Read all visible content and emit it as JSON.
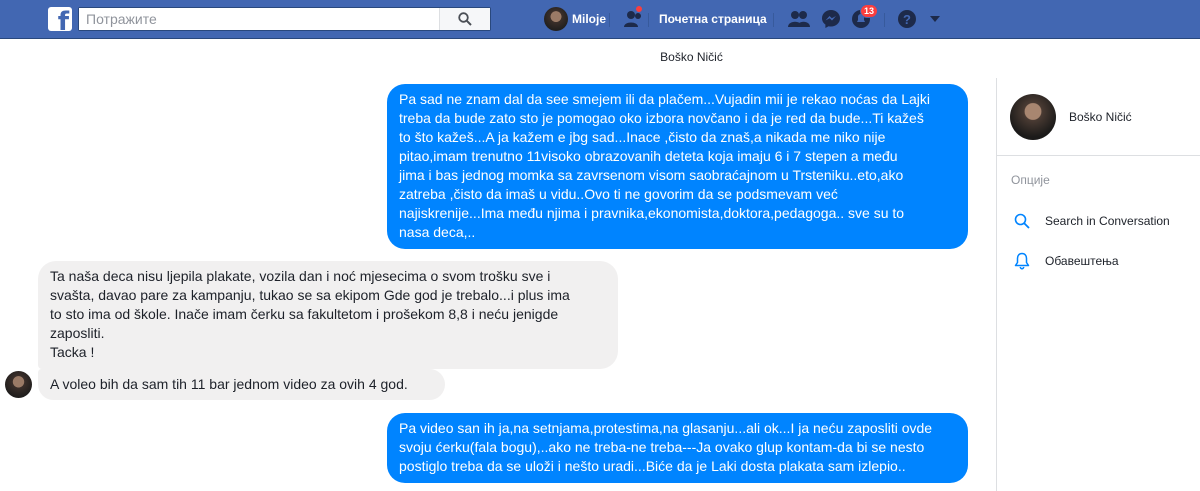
{
  "topbar": {
    "logo": "f",
    "search_placeholder": "Потражите",
    "profile_name": "Miloje",
    "home_label": "Почетна страница",
    "notification_count": "13",
    "icons": [
      "search-icon",
      "friend-requests-icon",
      "friends-icon",
      "messenger-icon",
      "notifications-icon",
      "help-icon",
      "chevron-down-icon"
    ]
  },
  "conversation": {
    "title": "Boško Ničić"
  },
  "messages": [
    {
      "direction": "outgoing",
      "lines": [
        "Pa sad ne znam dal da see smejem ili da plačem...Vujadin mii je rekao noćas da Lajki",
        "treba da bude zato sto je pomogao oko izbora novčano i da je red da bude...Ti kažeš",
        "to što kažeš...A ja kažem  e jbg sad...Inace ,čisto da znaš,a nikada me niko nije",
        "pitao,imam  trenutno 11visoko obrazovanih deteta koja imaju 6 i 7 stepen a među",
        "jima i bas jednog momka sa zavrsenom visom saobraćajnom u Trsteniku..eto,ako",
        "zatreba ,čisto da imaš u vidu..Ovo ti ne govorim da se podsmevam već",
        "najiskrenije...Ima među njima i pravnika,ekonomista,doktora,pedagoga..  sve su to",
        "nasa deca,.."
      ]
    },
    {
      "direction": "incoming",
      "lines": [
        "Ta naša deca nisu ljepila plakate, vozila dan i noć mjesecima o svom trošku sve i",
        "svašta, davao pare za kampanju, tukao se sa ekipom Gde god je trebalo...i plus ima",
        "to sto ima od škole. Inače imam čerku sa fakultetom i prošekom 8,8 i neću jenigde",
        "zaposliti.",
        "Tacka !"
      ]
    },
    {
      "direction": "incoming",
      "lines": [
        "A voleo bih da sam tih 11 bar jednom video za ovih 4 god."
      ]
    },
    {
      "direction": "outgoing",
      "lines": [
        "Pa video san ih ja,na setnjama,protestima,na glasanju...ali ok...I ja neću zaposliti ovde",
        "svoju ćerku(fala bogu),..ako ne treba-ne treba---Ja ovako glup kontam-da bi se nesto",
        "postiglo treba da se uloži i nešto uradi...Biće da  je Laki dosta plakata sam izlepio.."
      ]
    }
  ],
  "right_panel": {
    "contact_name": "Boško Ničić",
    "options_label": "Опције",
    "search_in_conversation": "Search in Conversation",
    "notifications": "Обавештења"
  },
  "colors": {
    "topbar": "#4267b2",
    "outgoing_bubble": "#0084ff",
    "incoming_bubble": "#f1f0f0",
    "accent": "#0084ff",
    "badge": "#fa3e3e"
  }
}
